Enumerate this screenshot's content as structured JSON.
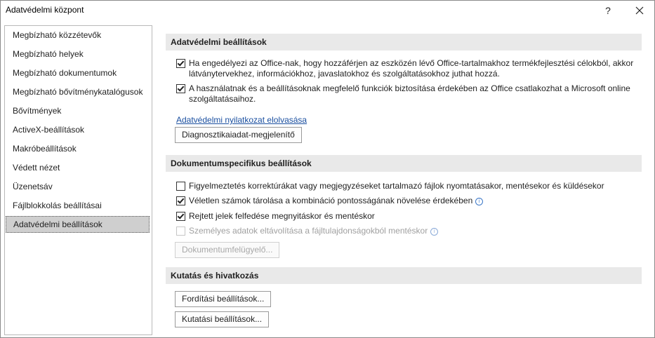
{
  "window": {
    "title": "Adatvédelmi központ",
    "help_label": "?"
  },
  "sidebar": {
    "items": [
      {
        "label": "Megbízható közzétevők"
      },
      {
        "label": "Megbízható helyek"
      },
      {
        "label": "Megbízható dokumentumok"
      },
      {
        "label": "Megbízható bővítménykatalógusok"
      },
      {
        "label": "Bővítmények"
      },
      {
        "label": "ActiveX-beállítások"
      },
      {
        "label": "Makróbeállítások"
      },
      {
        "label": "Védett nézet"
      },
      {
        "label": "Üzenetsáv"
      },
      {
        "label": "Fájlblokkolás beállításai"
      },
      {
        "label": "Adatvédelmi beállítások",
        "selected": true
      }
    ]
  },
  "privacy": {
    "header": "Adatvédelmi beállítások",
    "options": [
      {
        "label": "Ha engedélyezi az Office-nak, hogy hozzáférjen az eszközén lévő Office-tartalmakhoz termékfejlesztési célokból, akkor látványtervekhez, információkhoz, javaslatokhoz és szolgáltatásokhoz juthat hozzá.",
        "checked": true
      },
      {
        "label": "A használatnak és a beállításoknak megfelelő funkciók biztosítása érdekében az Office csatlakozhat a Microsoft online szolgáltatásaihoz.",
        "checked": true
      }
    ],
    "statement_link": "Adatvédelmi nyilatkozat elolvasása",
    "diagnostics_button": "Diagnosztikaiadat-megjelenítő"
  },
  "document": {
    "header": "Dokumentumspecifikus beállítások",
    "options": [
      {
        "label": "Figyelmeztetés korrektúrákat vagy megjegyzéseket tartalmazó fájlok nyomtatásakor, mentésekor és küldésekor",
        "checked": false
      },
      {
        "label": "Véletlen számok tárolása a kombináció pontosságának növelése érdekében",
        "checked": true,
        "info": "i"
      },
      {
        "label": "Rejtett jelek felfedése megnyitáskor és mentéskor",
        "checked": true
      },
      {
        "label": "Személyes adatok eltávolítása a fájltulajdonságokból mentéskor",
        "checked": false,
        "disabled": true,
        "info": "i"
      }
    ],
    "inspector_button": "Dokumentumfelügyelő..."
  },
  "research": {
    "header": "Kutatás és hivatkozás",
    "translation_button": "Fordítási beállítások...",
    "research_button": "Kutatási beállítások..."
  }
}
